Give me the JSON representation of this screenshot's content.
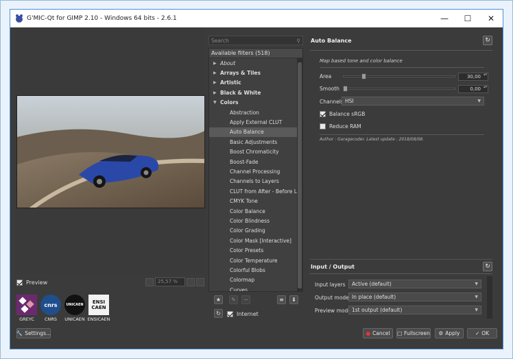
{
  "window": {
    "title": "G'MIC-Qt for GIMP 2.10 - Windows 64 bits - 2.6.1"
  },
  "preview": {
    "checkbox_label": "Preview",
    "zoom_value": "25,57 %"
  },
  "logos": [
    {
      "label": "GREYC",
      "text": "",
      "bg": "#6b2a6e",
      "fg": "#ffffff"
    },
    {
      "label": "CNRS",
      "text": "cnrs",
      "bg": "#1f4e8c",
      "fg": "#ffffff"
    },
    {
      "label": "UNICAEN",
      "text": "UNICAEN",
      "bg": "#111111",
      "fg": "#ffffff"
    },
    {
      "label": "ENSICAEN",
      "text": "ENSI CAEN",
      "bg": "#f2f2f2",
      "fg": "#111111"
    }
  ],
  "buttons": {
    "settings": "Settings...",
    "cancel": "Cancel",
    "fullscreen": "Fullscreen",
    "apply": "Apply",
    "ok": "OK"
  },
  "filters": {
    "search_placeholder": "Search",
    "header": "Available filters (518)",
    "categories": [
      {
        "label": "About",
        "italic": true
      },
      {
        "label": "Arrays & Tiles"
      },
      {
        "label": "Artistic"
      },
      {
        "label": "Black & White"
      },
      {
        "label": "Colors",
        "expanded": true
      }
    ],
    "items": [
      "Abstraction",
      "Apply External CLUT",
      "Auto Balance",
      "Basic Adjustments",
      "Boost Chromaticity",
      "Boost-Fade",
      "Channel Processing",
      "Channels to Layers",
      "CLUT from After - Before Layers",
      "CMYK Tone",
      "Color Balance",
      "Color Blindness",
      "Color Grading",
      "Color Mask [Interactive]",
      "Color Presets",
      "Color Temperature",
      "Colorful Blobs",
      "Colormap",
      "Curves"
    ],
    "selected": "Auto Balance",
    "internet_label": "Internet"
  },
  "filter_panel": {
    "name": "Auto Balance",
    "description": "Map based tone and color balance",
    "area_label": "Area",
    "area_value": "30,00",
    "area_fraction": 0.17,
    "smooth_label": "Smooth",
    "smooth_value": "0,00",
    "smooth_fraction": 0.0,
    "channels_label": "Channels",
    "channels_value": "HSI",
    "balance_srgb_label": "Balance sRGB",
    "balance_srgb_checked": true,
    "reduce_ram_label": "Reduce RAM",
    "reduce_ram_checked": false,
    "author": "Author : Garagecoder. Latest update : 2018/08/08."
  },
  "io": {
    "header": "Input / Output",
    "input_layers_label": "Input layers",
    "input_layers_value": "Active (default)",
    "output_mode_label": "Output mode",
    "output_mode_value": "In place (default)",
    "preview_mode_label": "Preview mode",
    "preview_mode_value": "1st output (default)"
  }
}
